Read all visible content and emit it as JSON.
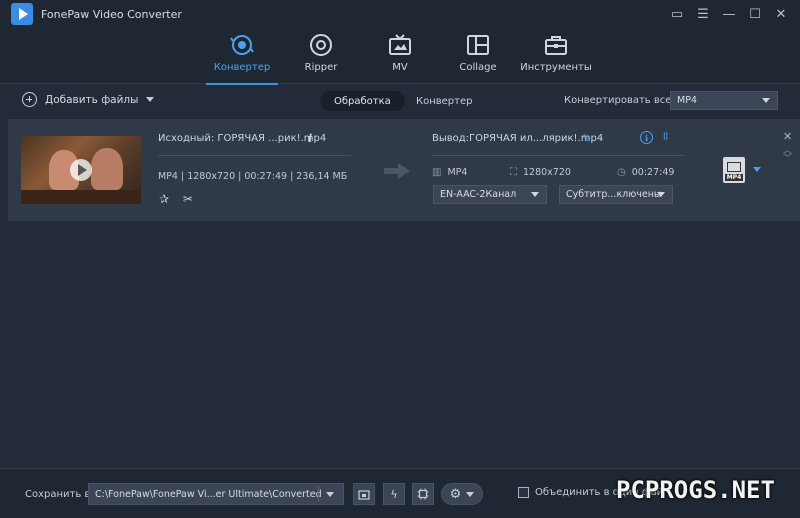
{
  "app": {
    "title": "FonePaw Video Converter"
  },
  "window_controls": {
    "feedback": "▭",
    "menu": "☰",
    "minimize": "—",
    "maximize": "☐",
    "close": "✕"
  },
  "nav": {
    "tabs": [
      {
        "label": "Конвертер",
        "icon": "converter-icon",
        "active": true
      },
      {
        "label": "Ripper",
        "icon": "disc-icon"
      },
      {
        "label": "MV",
        "icon": "tv-icon"
      },
      {
        "label": "Collage",
        "icon": "collage-icon"
      },
      {
        "label": "Инструменты",
        "icon": "toolbox-icon"
      }
    ]
  },
  "toolbar": {
    "add_files": "Добавить файлы",
    "seg_processing": "Обработка",
    "seg_converter": "Конвертер",
    "convert_all_label": "Конвертировать все в:",
    "convert_all_value": "MP4"
  },
  "file": {
    "source_name": "Исходный: ГОРЯЧАЯ ...рик!.mp4",
    "source_meta": "MP4 | 1280x720 | 00:27:49 | 236,14 МБ",
    "output_name": "Вывод:ГОРЯЧАЯ ил...лярик!.mp4",
    "out_format": "MP4",
    "out_resolution": "1280x720",
    "out_duration": "00:27:49",
    "audio_select": "EN-AAC-2Канал",
    "subtitle_select": "Субтитр...ключены",
    "format_badge": "MP4"
  },
  "bottom": {
    "save_label": "Сохранить в:",
    "save_path": "C:\\FonePaw\\FonePaw Vi...er Ultimate\\Converted",
    "merge_label": "Объединить в один фай"
  },
  "watermark": "PCPROGS.NET",
  "colors": {
    "accent": "#3d8fe0",
    "background": "#232b38",
    "card": "#2f3948",
    "chrome": "#1f2733"
  }
}
